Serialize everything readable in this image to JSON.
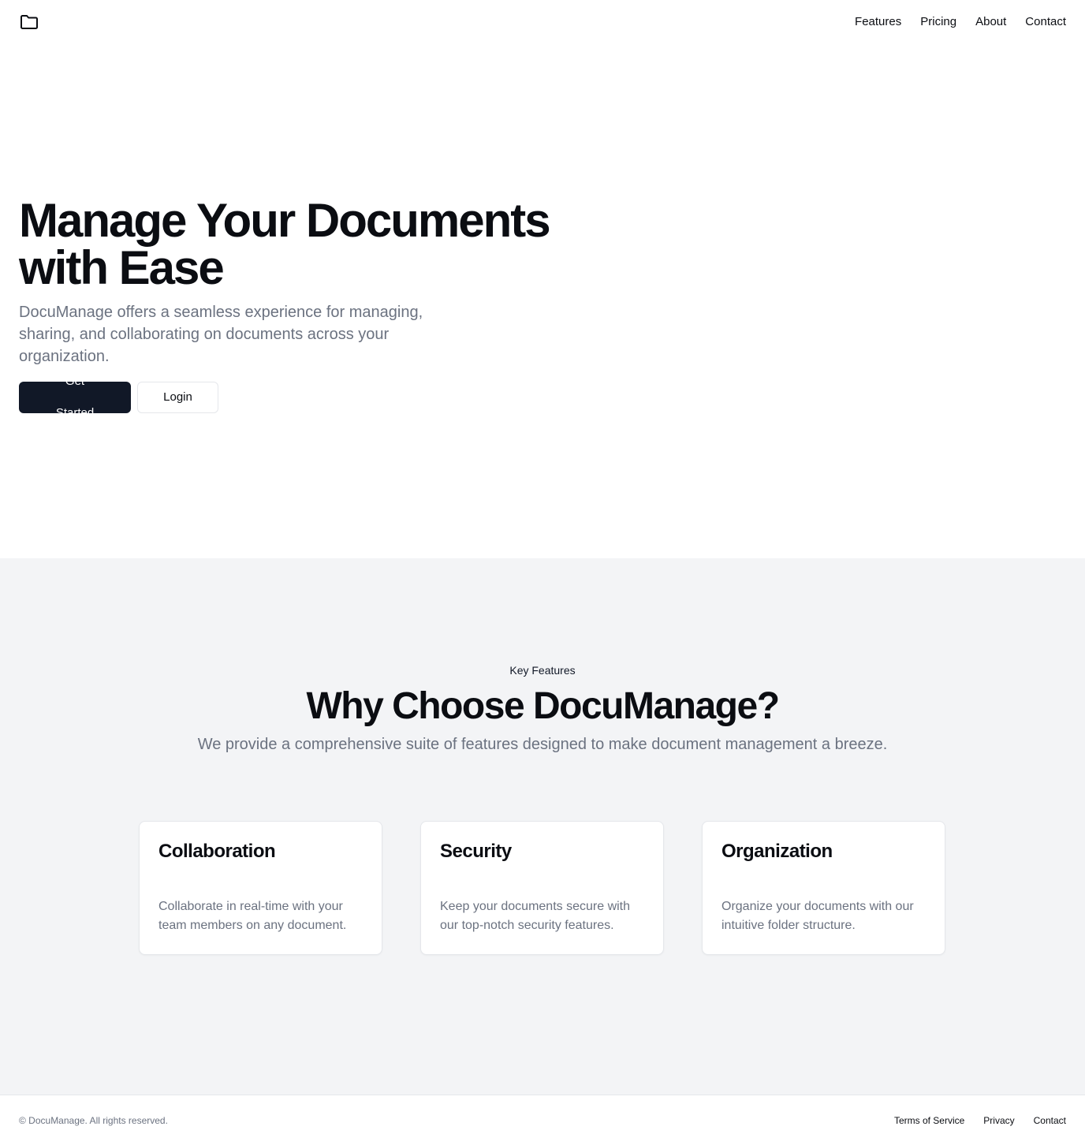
{
  "header": {
    "logo_icon": "folder-icon",
    "nav": [
      {
        "label": "Features"
      },
      {
        "label": "Pricing"
      },
      {
        "label": "About"
      },
      {
        "label": "Contact"
      }
    ]
  },
  "hero": {
    "title": "Manage Your Documents with Ease",
    "subtitle": "DocuManage offers a seamless experience for managing, sharing, and collaborating on documents across your organization.",
    "primary_button": "Get Started",
    "secondary_button": "Login"
  },
  "features": {
    "eyebrow": "Key Features",
    "title": "Why Choose DocuManage?",
    "subtitle": "We provide a comprehensive suite of features designed to make document management a breeze.",
    "cards": [
      {
        "title": "Collaboration",
        "text": "Collaborate in real-time with your team members on any document."
      },
      {
        "title": "Security",
        "text": "Keep your documents secure with our top-notch security features."
      },
      {
        "title": "Organization",
        "text": "Organize your documents with our intuitive folder structure."
      }
    ]
  },
  "footer": {
    "copyright": "© DocuManage. All rights reserved.",
    "links": [
      {
        "label": "Terms of Service"
      },
      {
        "label": "Privacy"
      },
      {
        "label": "Contact"
      }
    ]
  },
  "colors": {
    "primary": "#111827",
    "muted_text": "#6b7280",
    "section_bg": "#f3f4f6",
    "border": "#e5e7eb"
  }
}
